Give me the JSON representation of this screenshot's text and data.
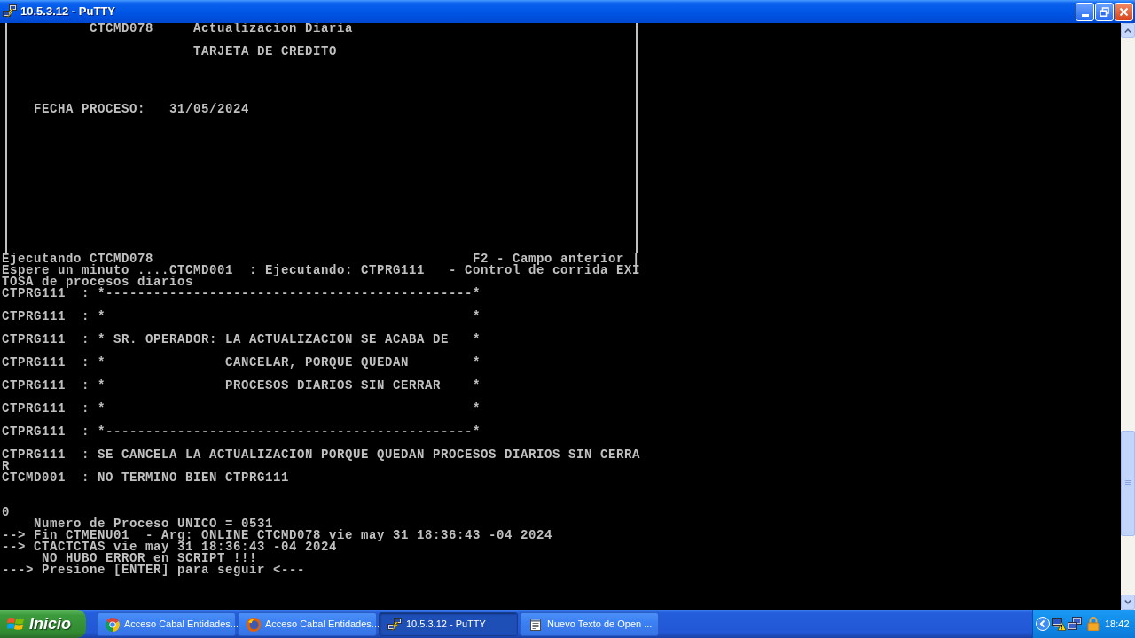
{
  "window": {
    "title": "10.5.3.12 - PuTTY"
  },
  "terminal": {
    "form_rows": [
      {
        "kind": "text",
        "text": "          CTCMD078     Actualizacion Diaria"
      },
      {
        "kind": "blank"
      },
      {
        "kind": "text",
        "text": "                       TARJETA DE CREDITO"
      },
      {
        "kind": "blank"
      },
      {
        "kind": "blank"
      },
      {
        "kind": "blank"
      },
      {
        "kind": "blank"
      },
      {
        "kind": "text",
        "text": "   FECHA PROCESO:   31/05/2024"
      },
      {
        "kind": "blank"
      },
      {
        "kind": "blank"
      },
      {
        "kind": "blank"
      },
      {
        "kind": "blank"
      },
      {
        "kind": "blank"
      },
      {
        "kind": "blank"
      },
      {
        "kind": "blank"
      },
      {
        "kind": "blank"
      },
      {
        "kind": "blank"
      },
      {
        "kind": "blank"
      },
      {
        "kind": "blank"
      },
      {
        "kind": "blank"
      }
    ],
    "output_rows": [
      {
        "kind": "split",
        "left": "Ejecutando CTCMD078",
        "right": "F2 - Campo anterior |"
      },
      {
        "kind": "text",
        "text": "Espere un minuto ....CTCMD001  : Ejecutando: CTPRG111   - Control de corrida EXI"
      },
      {
        "kind": "text",
        "text": "TOSA de procesos diarios"
      },
      {
        "kind": "text",
        "text": "CTPRG111  : *----------------------------------------------*"
      },
      {
        "kind": "blank"
      },
      {
        "kind": "text",
        "text": "CTPRG111  : *                                              *"
      },
      {
        "kind": "blank"
      },
      {
        "kind": "text",
        "text": "CTPRG111  : * SR. OPERADOR: LA ACTUALIZACION SE ACABA DE   *"
      },
      {
        "kind": "blank"
      },
      {
        "kind": "text",
        "text": "CTPRG111  : *               CANCELAR, PORQUE QUEDAN        *"
      },
      {
        "kind": "blank"
      },
      {
        "kind": "text",
        "text": "CTPRG111  : *               PROCESOS DIARIOS SIN CERRAR    *"
      },
      {
        "kind": "blank"
      },
      {
        "kind": "text",
        "text": "CTPRG111  : *                                              *"
      },
      {
        "kind": "blank"
      },
      {
        "kind": "text",
        "text": "CTPRG111  : *----------------------------------------------*"
      },
      {
        "kind": "blank"
      },
      {
        "kind": "text",
        "text": "CTPRG111  : SE CANCELA LA ACTUALIZACION PORQUE QUEDAN PROCESOS DIARIOS SIN CERRA"
      },
      {
        "kind": "text",
        "text": "R"
      },
      {
        "kind": "text",
        "text": "CTCMD001  : NO TERMINO BIEN CTPRG111"
      },
      {
        "kind": "blank"
      },
      {
        "kind": "blank"
      },
      {
        "kind": "text",
        "text": "0"
      },
      {
        "kind": "text",
        "text": "    Numero de Proceso UNICO = 0531"
      },
      {
        "kind": "text",
        "text": "--> Fin CTMENU01  - Arg: ONLINE CTCMD078 vie may 31 18:36:43 -04 2024"
      },
      {
        "kind": "text",
        "text": "--> CTACTCTAS vie may 31 18:36:43 -04 2024"
      },
      {
        "kind": "text",
        "text": "     NO HUBO ERROR en SCRIPT !!!"
      },
      {
        "kind": "text",
        "text": "---> Presione [ENTER] para seguir <---"
      }
    ]
  },
  "taskbar": {
    "start_label": "Inicio",
    "buttons": [
      {
        "label": "Acceso Cabal Entidades...",
        "selected": false
      },
      {
        "label": "Acceso Cabal Entidades...",
        "selected": false
      },
      {
        "label": "10.5.3.12 - PuTTY",
        "selected": true
      },
      {
        "label": "Nuevo Texto de Open ...",
        "selected": false
      }
    ],
    "clock": "18:42"
  }
}
